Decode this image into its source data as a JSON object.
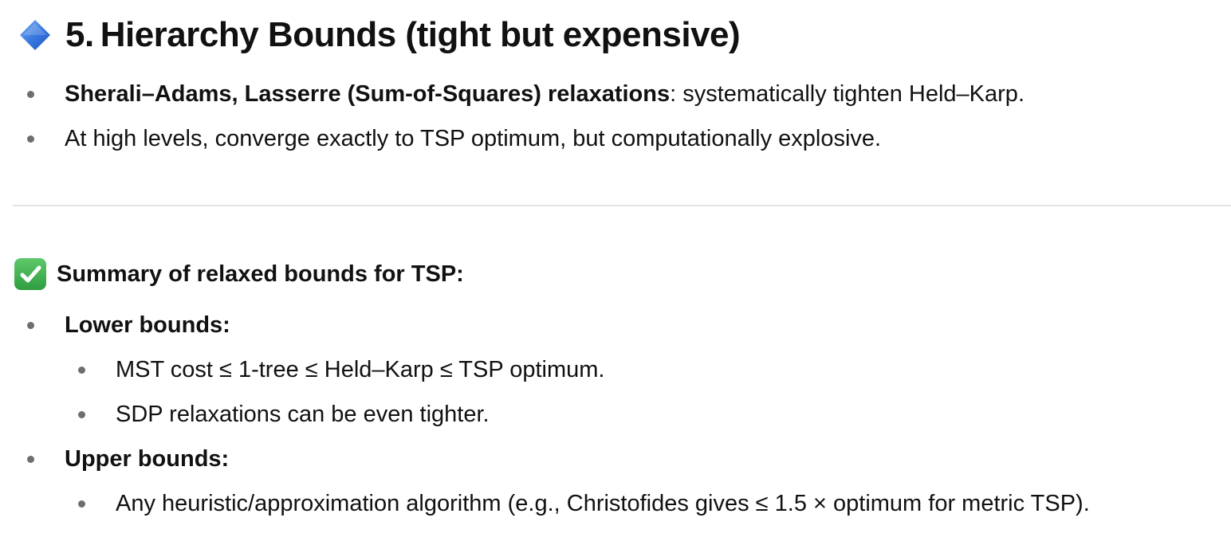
{
  "section": {
    "number": "5.",
    "title": "Hierarchy Bounds (tight but expensive)",
    "icon": "blue-diamond-icon",
    "bullets": [
      {
        "bold": "Sherali–Adams, Lasserre (Sum-of-Squares) relaxations",
        "text": ": systematically tighten Held–Karp."
      },
      {
        "bold": "",
        "text": "At high levels, converge exactly to TSP optimum, but computationally explosive."
      }
    ]
  },
  "summary": {
    "icon": "check-mark-button-icon",
    "title": "Summary of relaxed bounds for TSP:",
    "groups": [
      {
        "label": "Lower bounds:",
        "items": [
          "MST cost ≤ 1-tree ≤ Held–Karp ≤ TSP optimum.",
          "SDP relaxations can be even tighter."
        ]
      },
      {
        "label": "Upper bounds:",
        "items": [
          "Any heuristic/approximation algorithm (e.g., Christofides gives ≤ 1.5 × optimum for metric TSP)."
        ]
      }
    ]
  },
  "colors": {
    "diamond": "#2f6fd8",
    "check_background": "#3fb950",
    "bullet": "#6e6e6e",
    "divider": "#e2e2e2"
  }
}
